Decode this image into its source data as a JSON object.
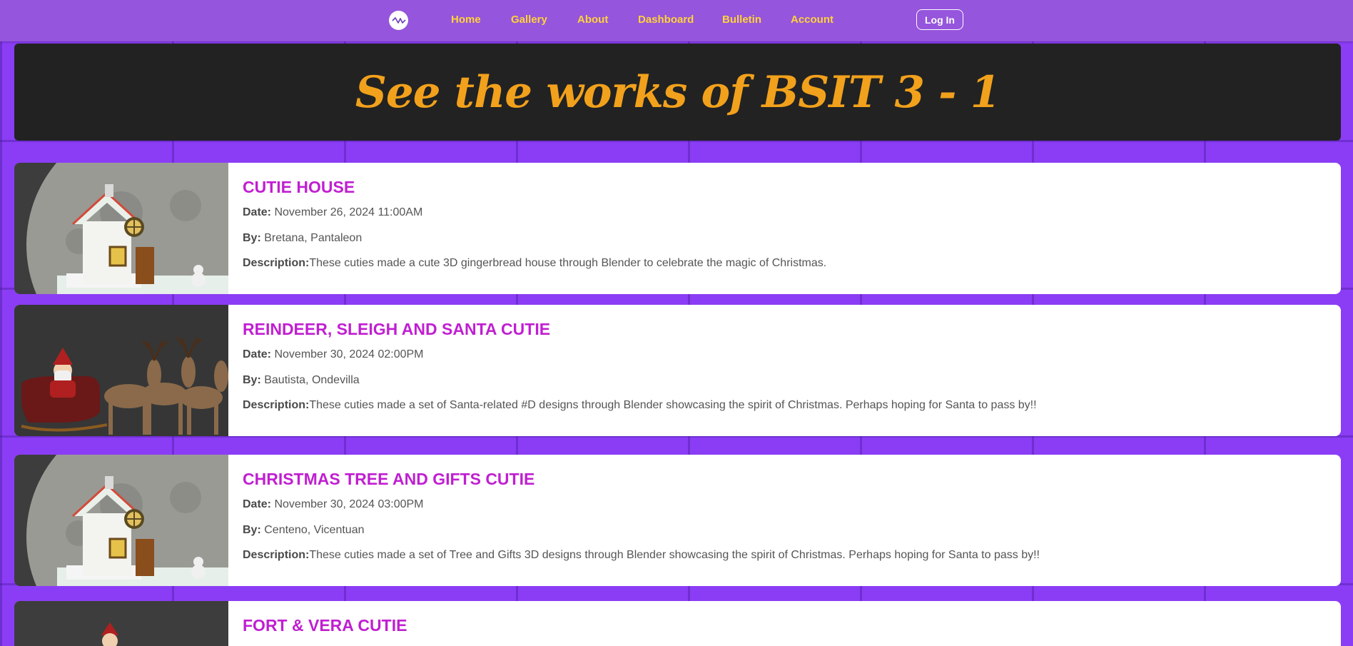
{
  "nav": {
    "logo_icon": "wave-logo-icon",
    "links": [
      "Home",
      "Gallery",
      "About",
      "Dashboard",
      "Bulletin",
      "Account"
    ],
    "login_label": "Log In"
  },
  "banner": {
    "title": "See the works of BSIT 3 - 1"
  },
  "labels": {
    "date": "Date:",
    "by": "By:",
    "description": "Description:"
  },
  "cards": [
    {
      "title": "CUTIE HOUSE",
      "date": "November 26, 2024 11:00AM",
      "by": "Bretana, Pantaleon",
      "description": "These cuties made a cute 3D gingerbread house through Blender to celebrate the magic of Christmas.",
      "image": "gingerbread-house-render"
    },
    {
      "title": "REINDEER, SLEIGH AND SANTA CUTIE",
      "date": "November 30, 2024 02:00PM",
      "by": "Bautista, Ondevilla",
      "description": "These cuties made a set of Santa-related #D designs through Blender showcasing the spirit of Christmas. Perhaps hoping for Santa to pass by!!",
      "image": "santa-sleigh-reindeer-render"
    },
    {
      "title": "CHRISTMAS TREE AND GIFTS CUTIE",
      "date": "November 30, 2024 03:00PM",
      "by": "Centeno, Vicentuan",
      "description": "These cuties made a set of Tree and Gifts 3D designs through Blender showcasing the spirit of Christmas. Perhaps hoping for Santa to pass by!!",
      "image": "gingerbread-house-render"
    },
    {
      "title": "FORT & VERA CUTIE",
      "image": "santa-figure-render"
    }
  ],
  "colors": {
    "nav_bg": "#9555dc",
    "nav_link": "#ffd23a",
    "page_bg": "#8b3df5",
    "banner_bg": "#222222",
    "banner_text": "#f2a11c",
    "card_title": "#c01fd1"
  }
}
